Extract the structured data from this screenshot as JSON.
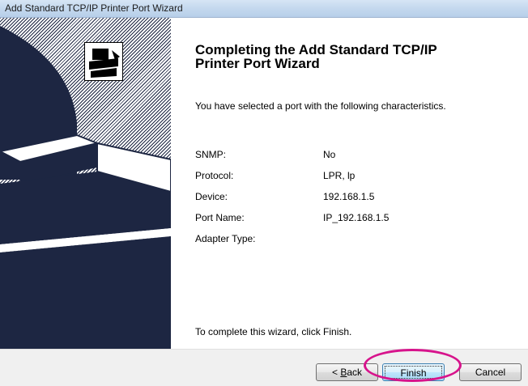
{
  "window": {
    "title": "Add Standard TCP/IP Printer Port Wizard"
  },
  "colors": {
    "titlebar": "#c4d8ee",
    "side_panel_dark": "#1d2642",
    "highlight_ring": "#d7148c",
    "default_button_border": "#3c7fb1"
  },
  "side_panel": {
    "icon": "printer-wizard-icon"
  },
  "content": {
    "heading_line1": "Completing the Add Standard TCP/IP",
    "heading_line2": "Printer Port Wizard",
    "intro": "You have selected a port with the following characteristics.",
    "details": [
      {
        "label": "SNMP:",
        "value": "No"
      },
      {
        "label": "Protocol:",
        "value": "LPR, lp"
      },
      {
        "label": "Device:",
        "value": "192.168.1.5"
      },
      {
        "label": "Port Name:",
        "value": "IP_192.168.1.5"
      },
      {
        "label": "Adapter Type:",
        "value": ""
      }
    ],
    "footer": "To complete this wizard, click Finish."
  },
  "buttons": {
    "back_prefix": "< ",
    "back_accel": "B",
    "back_rest": "ack",
    "finish": "Finish",
    "cancel": "Cancel"
  }
}
